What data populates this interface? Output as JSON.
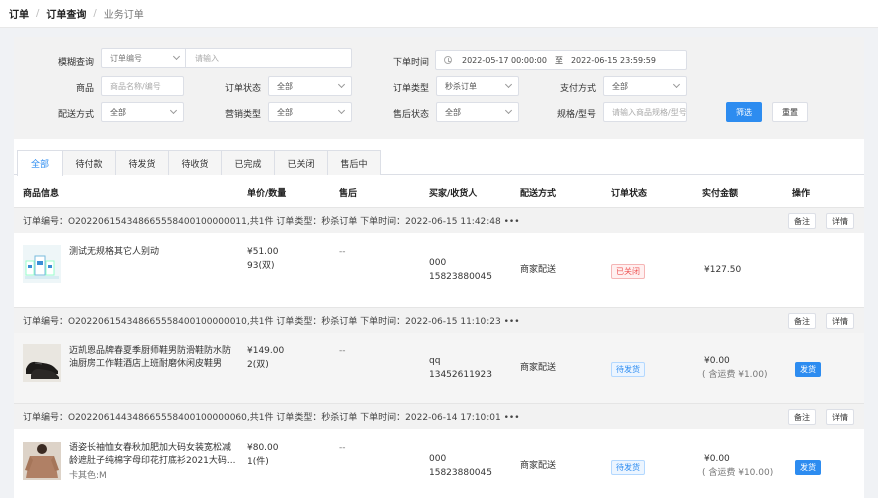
{
  "breadcrumb": [
    "订单",
    "订单查询",
    "业务订单"
  ],
  "filters": {
    "fuzzy_label": "模糊查询",
    "fuzzy_type": "订单编号",
    "fuzzy_placeholder": "请输入",
    "order_time_label": "下单时间",
    "date_start": "2022-05-17 00:00:00",
    "date_to": "至",
    "date_end": "2022-06-15 23:59:59",
    "product_label": "商品",
    "product_placeholder": "商品名称/编号",
    "order_status_label": "订单状态",
    "order_status_value": "全部",
    "order_type_label": "订单类型",
    "order_type_value": "秒杀订单",
    "pay_label": "支付方式",
    "pay_value": "全部",
    "delivery_label": "配送方式",
    "delivery_value": "全部",
    "marketing_label": "营销类型",
    "marketing_value": "全部",
    "aftersale_label": "售后状态",
    "aftersale_value": "全部",
    "spec_label": "规格/型号",
    "spec_placeholder": "请输入商品规格/型号",
    "filter_button": "筛选",
    "reset_button": "重置"
  },
  "tabs": [
    "全部",
    "待付款",
    "待发货",
    "待收货",
    "已完成",
    "已关闭",
    "售后中"
  ],
  "columns": [
    "商品信息",
    "单价/数量",
    "售后",
    "买家/收货人",
    "配送方式",
    "订单状态",
    "实付金额",
    "操作"
  ],
  "orders": [
    {
      "header": "订单编号：O20220615434866555840010000001​1,共1件 订单类型：秒杀订单 下单时间：2022-06-15 11:42:48 •••",
      "note_button": "备注",
      "detail_button": "详情",
      "product_name": "测试无规格其它人别动",
      "product_spec": "",
      "price": "¥51.00",
      "qty": "93(双)",
      "aftersale": "--",
      "buyer_name": "000",
      "buyer_phone": "15823880045",
      "delivery": "商家配送",
      "status": "已关闭",
      "amount": "¥127.50",
      "shipping_fee": "",
      "action": ""
    },
    {
      "header": "订单编号：O20220615434866555840010000001​0,共1件 订单类型：秒杀订单 下单时间：2022-06-15 11:10:23 •••",
      "note_button": "备注",
      "detail_button": "详情",
      "product_name": "迈凯恩品牌春夏季厨师鞋男防滑鞋防水防油厨房工作鞋酒店上班耐磨休闲皮鞋男",
      "product_spec": "",
      "price": "¥149.00",
      "qty": "2(双)",
      "aftersale": "--",
      "buyer_name": "qq",
      "buyer_phone": "13452611923",
      "delivery": "商家配送",
      "status": "待发货",
      "amount": "¥0.00",
      "shipping_fee": "( 含运费 ¥1.00)",
      "action": "发货"
    },
    {
      "header": "订单编号：O20220614434866555840010000006​0,共1件 订单类型：秒杀订单 下单时间：2022-06-14 17:10:01 •••",
      "note_button": "备注",
      "detail_button": "详情",
      "product_name": "语姿长袖恤女春秋加肥加大码女装宽松减龄遮肚子纯棉字母印花打底衫2021大码...",
      "product_spec": "卡其色:M",
      "price": "¥80.00",
      "qty": "1(件)",
      "aftersale": "--",
      "buyer_name": "000",
      "buyer_phone": "15823880045",
      "delivery": "商家配送",
      "status": "待发货",
      "amount": "¥0.00",
      "shipping_fee": "( 含运费 ¥10.00)",
      "action": "发货"
    }
  ]
}
